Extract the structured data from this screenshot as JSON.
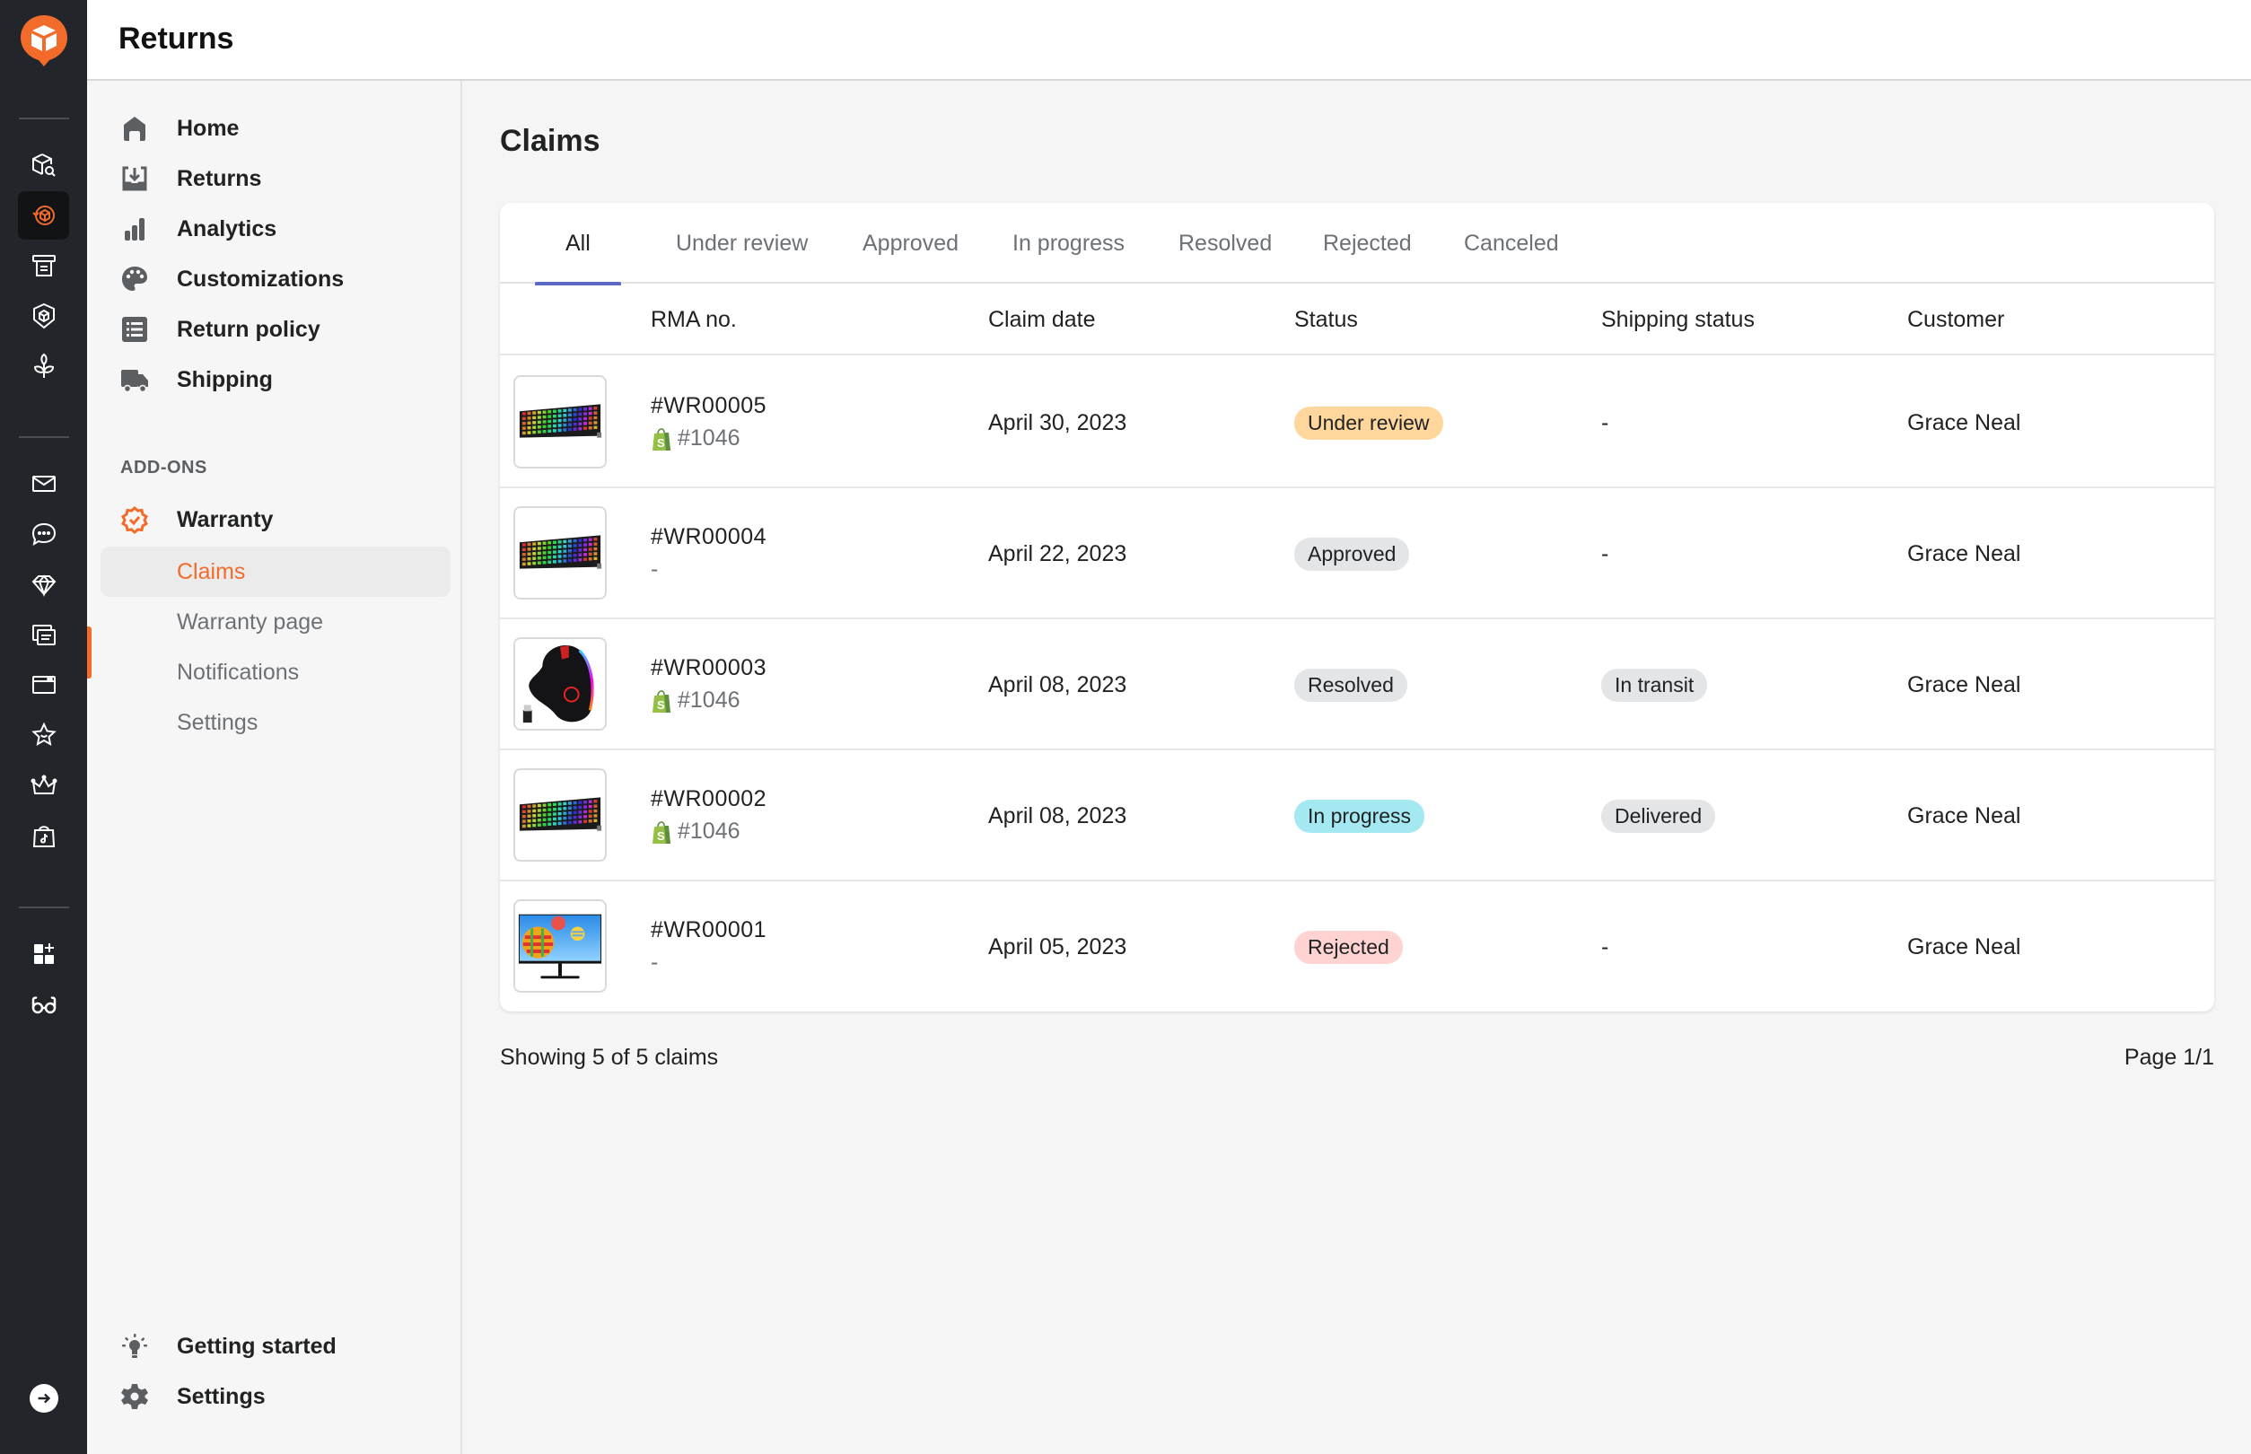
{
  "app": {
    "header_title": "Returns",
    "brand_color": "#f26b2a",
    "accent_tab_color": "#5c6ac4"
  },
  "rail": {
    "groups": [
      [
        "cube-search-icon",
        "returns-cycle-icon",
        "receipt-printer-icon",
        "shield-cube-icon",
        "sprout-icon"
      ],
      [
        "mail-icon",
        "chat-bubble-icon",
        "diamond-icon",
        "documents-icon",
        "browser-window-icon",
        "star-smile-icon",
        "crown-icon",
        "tiktok-shop-icon"
      ],
      [
        "add-apps-icon",
        "glasses-icon"
      ]
    ],
    "active": "returns-cycle-icon"
  },
  "sidebar": {
    "items": [
      {
        "label": "Home",
        "icon": "home-icon"
      },
      {
        "label": "Returns",
        "icon": "inbox-download-icon"
      },
      {
        "label": "Analytics",
        "icon": "bar-chart-icon"
      },
      {
        "label": "Customizations",
        "icon": "palette-icon"
      },
      {
        "label": "Return policy",
        "icon": "list-icon"
      },
      {
        "label": "Shipping",
        "icon": "truck-icon"
      }
    ],
    "section_label": "ADD-ONS",
    "addon": {
      "label": "Warranty",
      "icon": "verified-badge-icon"
    },
    "sub_items": [
      {
        "label": "Claims",
        "active": true
      },
      {
        "label": "Warranty page",
        "active": false
      },
      {
        "label": "Notifications",
        "active": false
      },
      {
        "label": "Settings",
        "active": false
      }
    ],
    "footer": [
      {
        "label": "Getting started",
        "icon": "lightbulb-icon"
      },
      {
        "label": "Settings",
        "icon": "gear-icon"
      }
    ]
  },
  "main": {
    "title": "Claims",
    "tabs": [
      {
        "label": "All",
        "active": true
      },
      {
        "label": "Under review",
        "active": false
      },
      {
        "label": "Approved",
        "active": false
      },
      {
        "label": "In progress",
        "active": false
      },
      {
        "label": "Resolved",
        "active": false
      },
      {
        "label": "Rejected",
        "active": false
      },
      {
        "label": "Canceled",
        "active": false
      }
    ],
    "columns": [
      "RMA no.",
      "Claim date",
      "Status",
      "Shipping status",
      "Customer"
    ],
    "rows": [
      {
        "product": "keyboard",
        "rma": "#WR00005",
        "order": "#1046",
        "has_shopify": true,
        "date": "April 30, 2023",
        "status": "Under review",
        "status_color": "#ffd79d",
        "shipping": "-",
        "shipping_badge": false,
        "customer": "Grace Neal"
      },
      {
        "product": "keyboard",
        "rma": "#WR00004",
        "order": "-",
        "has_shopify": false,
        "date": "April 22, 2023",
        "status": "Approved",
        "status_color": "#e4e5e7",
        "shipping": "-",
        "shipping_badge": false,
        "customer": "Grace Neal"
      },
      {
        "product": "mouse",
        "rma": "#WR00003",
        "order": "#1046",
        "has_shopify": true,
        "date": "April 08, 2023",
        "status": "Resolved",
        "status_color": "#e4e5e7",
        "shipping": "In transit",
        "shipping_badge": true,
        "customer": "Grace Neal"
      },
      {
        "product": "keyboard",
        "rma": "#WR00002",
        "order": "#1046",
        "has_shopify": true,
        "date": "April 08, 2023",
        "status": "In progress",
        "status_color": "#a4e8f2",
        "shipping": "Delivered",
        "shipping_badge": true,
        "customer": "Grace Neal"
      },
      {
        "product": "monitor",
        "rma": "#WR00001",
        "order": "-",
        "has_shopify": false,
        "date": "April 05, 2023",
        "status": "Rejected",
        "status_color": "#fed3d1",
        "shipping": "-",
        "shipping_badge": false,
        "customer": "Grace Neal"
      }
    ],
    "footer_left": "Showing 5 of 5 claims",
    "footer_right": "Page 1/1"
  }
}
